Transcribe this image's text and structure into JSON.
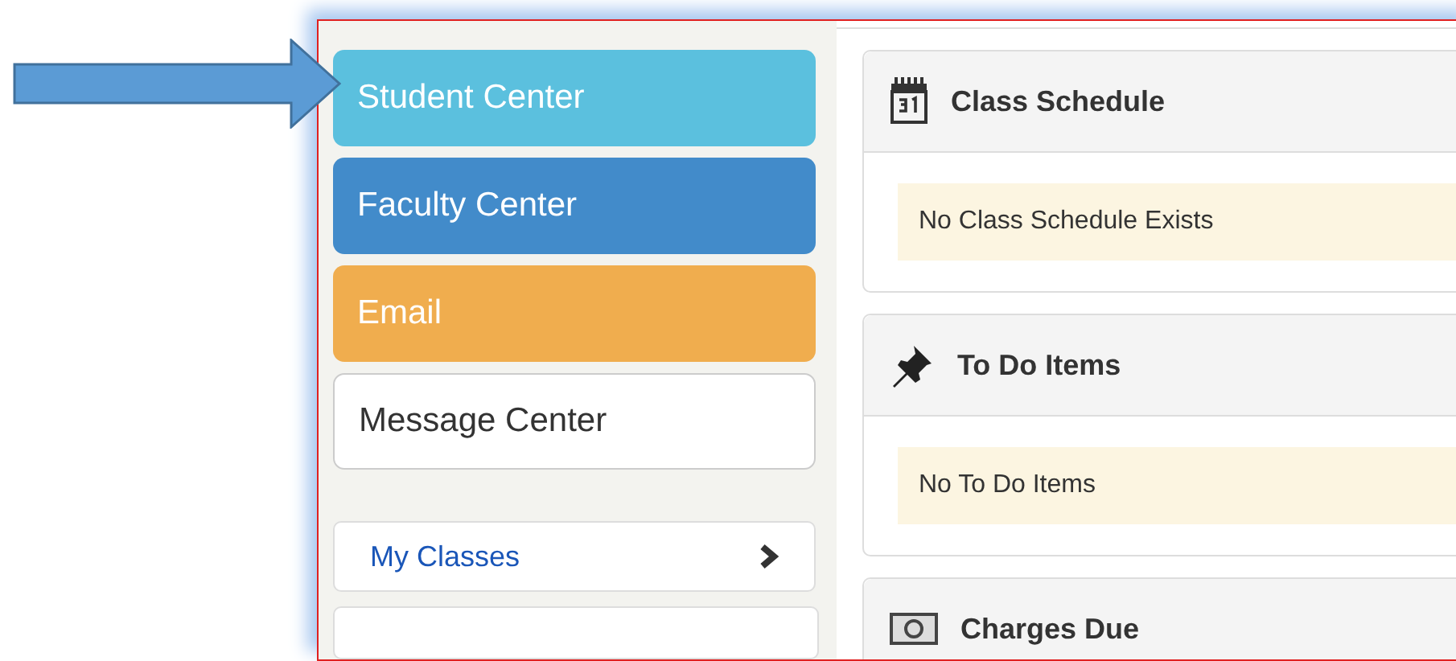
{
  "sidebar": {
    "tiles": [
      {
        "label": "Student Center",
        "color": "#5bc0de"
      },
      {
        "label": "Faculty Center",
        "color": "#428bca"
      },
      {
        "label": "Email",
        "color": "#f0ad4e"
      },
      {
        "label": "Message Center",
        "color": "#ffffff"
      }
    ],
    "links": [
      {
        "label": "My Classes"
      }
    ]
  },
  "cards": [
    {
      "kind": "calendar",
      "title": "Class Schedule",
      "message": "No Class Schedule Exists"
    },
    {
      "kind": "pin",
      "title": "To Do Items",
      "message": "No To Do Items"
    },
    {
      "kind": "money",
      "title": "Charges Due"
    }
  ]
}
